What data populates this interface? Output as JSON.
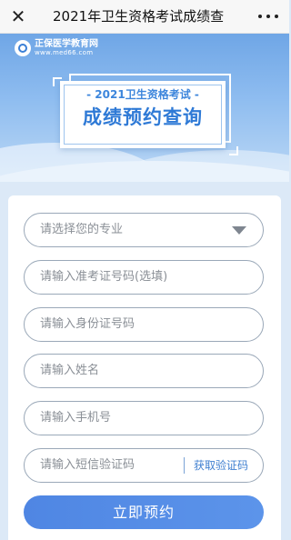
{
  "nav": {
    "title": "2021年卫生资格考试成绩查",
    "close_icon": "close-icon",
    "more_icon": "more-dots-icon"
  },
  "banner": {
    "logo_name": "正保医学教育网",
    "logo_url": "www.med66.com",
    "subtitle": "- 2021卫生资格考试 -",
    "title": "成绩预约查询"
  },
  "form": {
    "major_placeholder": "请选择您的专业",
    "ticket_placeholder": "请输入准考证号码(选填)",
    "id_placeholder": "请输入身份证号码",
    "name_placeholder": "请输入姓名",
    "phone_placeholder": "请输入手机号",
    "sms_placeholder": "请输入短信验证码",
    "get_code_label": "获取验证码",
    "submit_label": "立即预约"
  },
  "colors": {
    "accent": "#4f86e3",
    "banner_top": "#6fa6e6",
    "border": "#9aa8b8"
  }
}
